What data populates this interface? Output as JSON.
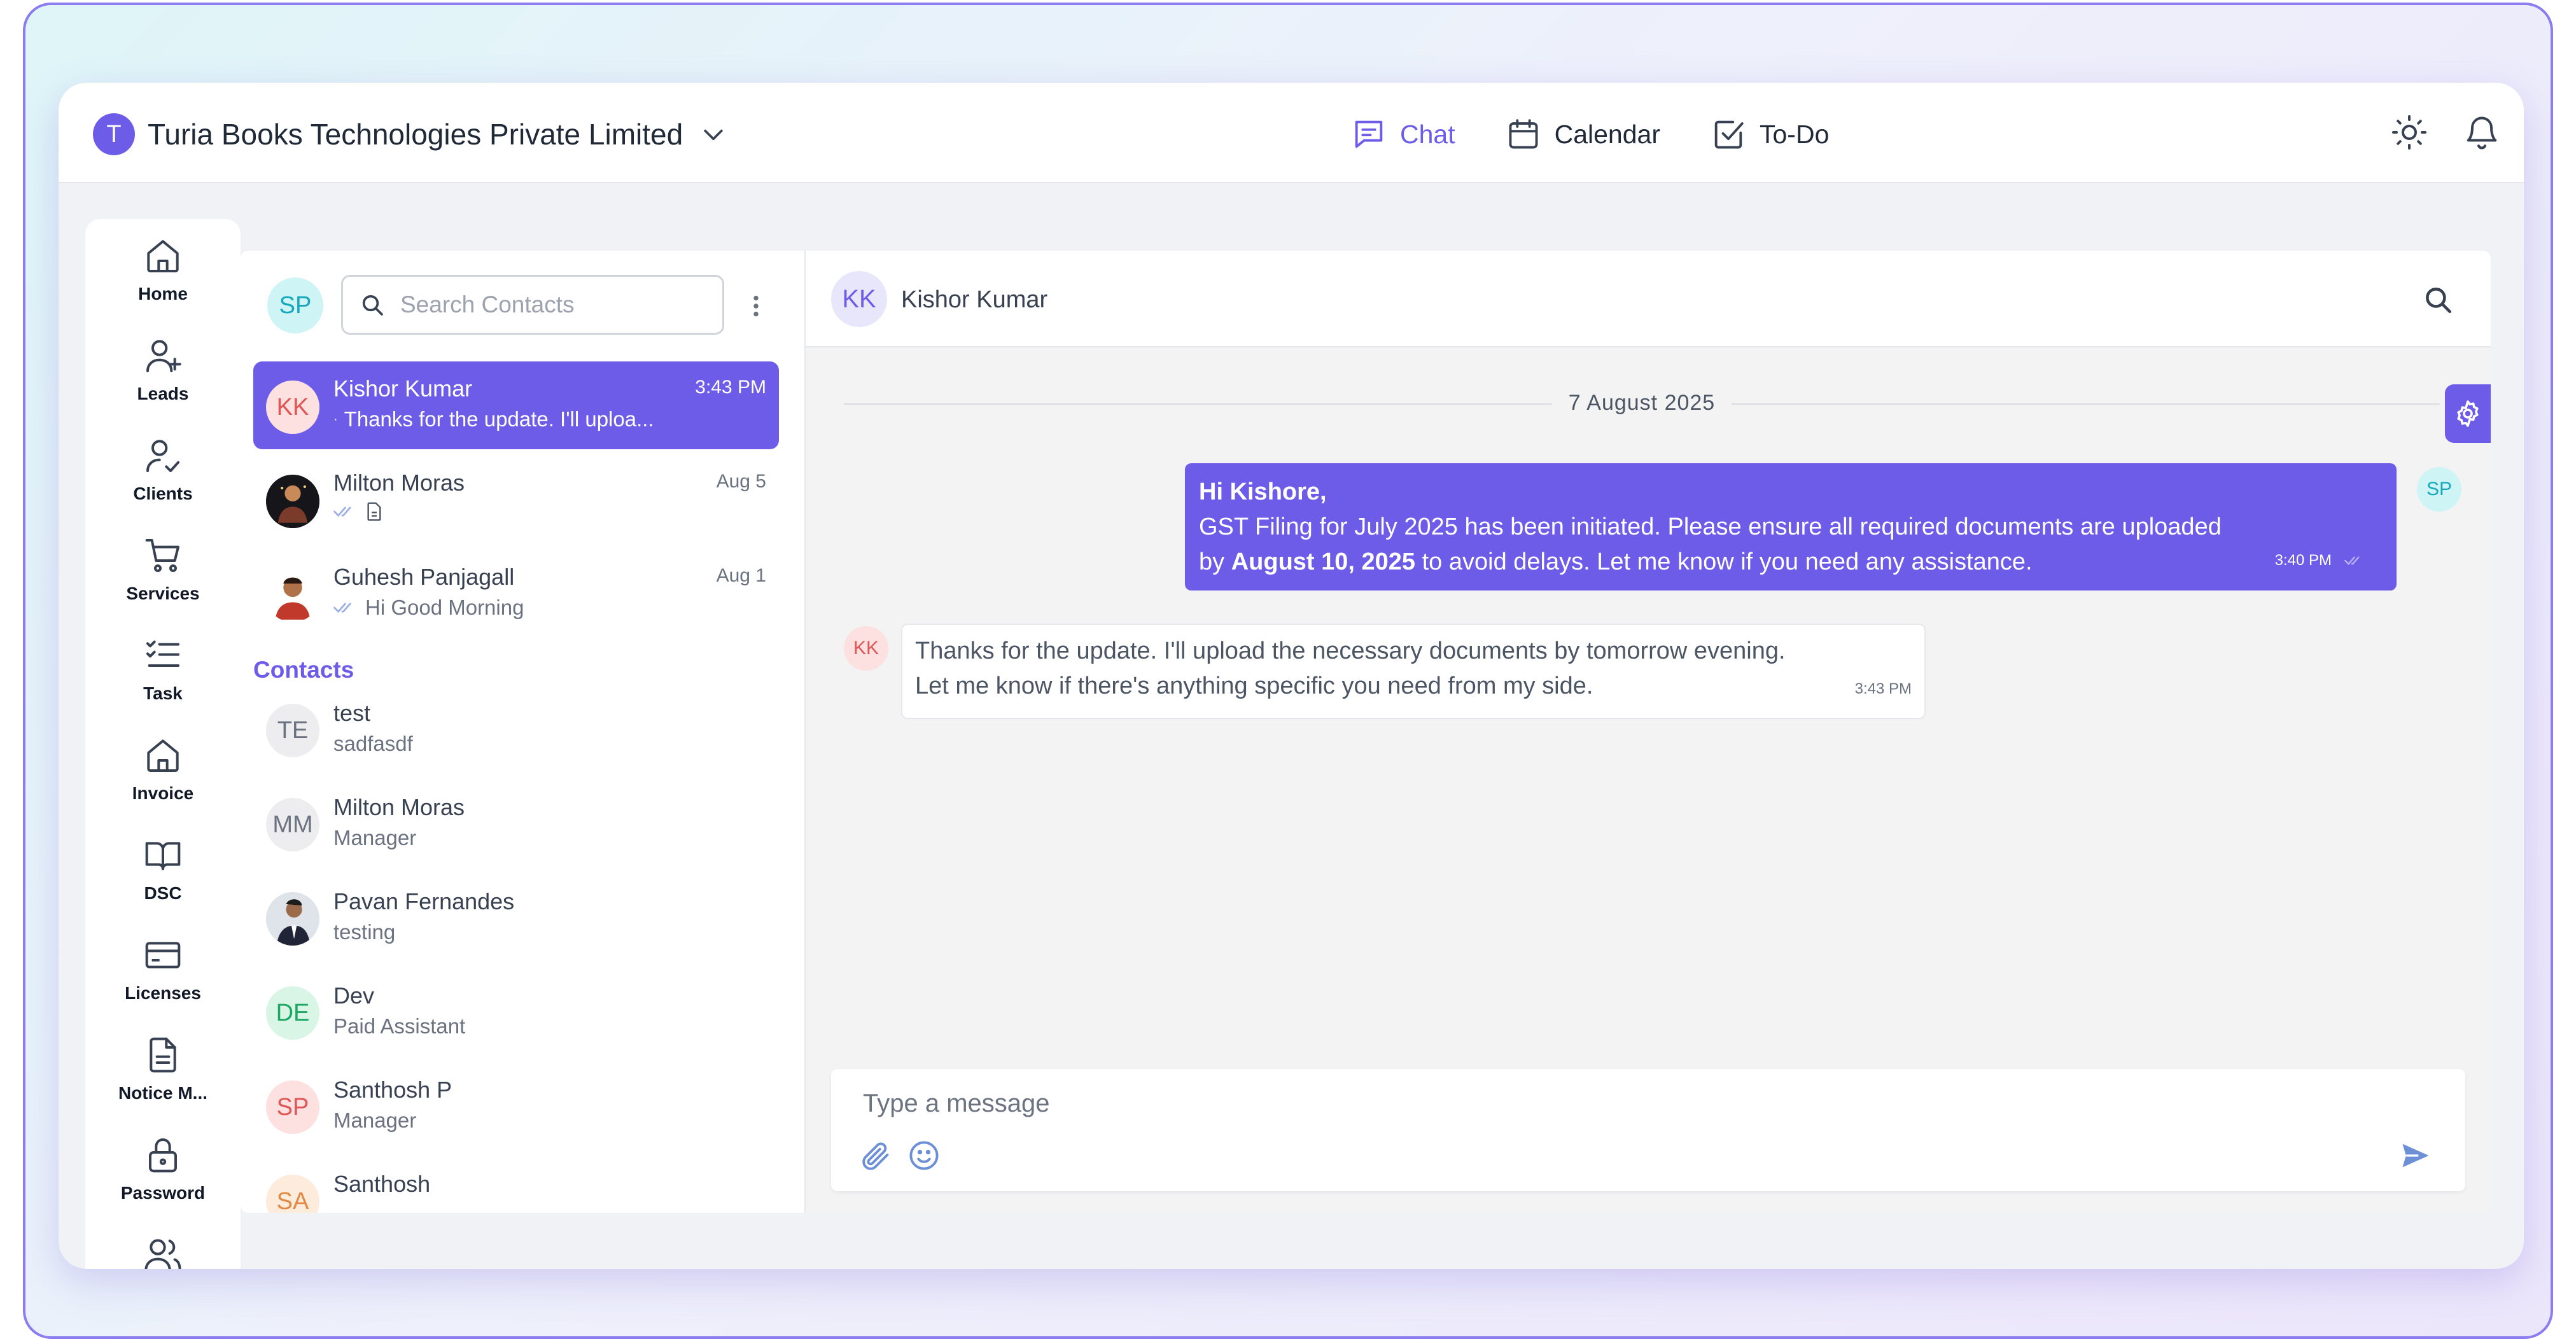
{
  "org": {
    "initial": "T",
    "name": "Turia Books Technologies Private Limited"
  },
  "topnav": [
    {
      "label": "Chat",
      "icon": "chat-icon",
      "active": true
    },
    {
      "label": "Calendar",
      "icon": "calendar-icon",
      "active": false
    },
    {
      "label": "To-Do",
      "icon": "checkbox-icon",
      "active": false
    }
  ],
  "sidebar": {
    "items": [
      {
        "label": "Home",
        "icon": "home-icon"
      },
      {
        "label": "Leads",
        "icon": "user-plus-icon"
      },
      {
        "label": "Clients",
        "icon": "user-check-icon"
      },
      {
        "label": "Services",
        "icon": "cart-icon"
      },
      {
        "label": "Task",
        "icon": "list-check-icon"
      },
      {
        "label": "Invoice",
        "icon": "home-icon"
      },
      {
        "label": "DSC",
        "icon": "book-icon"
      },
      {
        "label": "Licenses",
        "icon": "card-icon"
      },
      {
        "label": "Notice M...",
        "icon": "document-icon"
      },
      {
        "label": "Password",
        "icon": "lock-icon"
      }
    ]
  },
  "me": {
    "initials": "SP"
  },
  "search": {
    "placeholder": "Search Contacts"
  },
  "conversations": [
    {
      "initials": "KK",
      "name": "Kishor Kumar",
      "time": "3:43 PM",
      "preview": "Thanks for the update. I'll uploa..."
    },
    {
      "initials": "",
      "name": "Milton Moras",
      "time": "Aug 5",
      "preview": ""
    },
    {
      "initials": "",
      "name": "Guhesh Panjagall",
      "time": "Aug 1",
      "preview": "Hi Good Morning"
    }
  ],
  "contacts_heading": "Contacts",
  "contacts": [
    {
      "initials": "TE",
      "name": "test",
      "subtitle": "sadfasdf"
    },
    {
      "initials": "MM",
      "name": "Milton Moras",
      "subtitle": "Manager"
    },
    {
      "initials": "",
      "name": "Pavan Fernandes",
      "subtitle": "testing"
    },
    {
      "initials": "DE",
      "name": "Dev",
      "subtitle": "Paid Assistant"
    },
    {
      "initials": "SP",
      "name": "Santhosh P",
      "subtitle": "Manager"
    },
    {
      "initials": "SA",
      "name": "Santhosh",
      "subtitle": ""
    }
  ],
  "chat": {
    "contact_initials": "KK",
    "contact_name": "Kishor Kumar",
    "date": "7 August 2025",
    "outgoing": {
      "greeting": "Hi Kishore,",
      "line1": "GST Filing for July 2025 has been initiated. Please ensure all required documents are uploaded",
      "line2_pre": "by ",
      "line2_bold": "August 10, 2025",
      "line2_post": " to avoid delays. Let me know if you need any assistance.",
      "time": "3:40 PM",
      "sender_initials": "SP"
    },
    "incoming": {
      "sender_initials": "KK",
      "line1": "Thanks for the update. I'll upload the necessary documents by tomorrow evening.",
      "line2": "Let me know if there's anything specific you need from my side.",
      "time": "3:43 PM"
    },
    "composer_placeholder": "Type a message"
  },
  "colors": {
    "accent": "#6d5ce8",
    "sp_bg": "#cff4f6",
    "kk_bg": "#fde0e0",
    "de_bg": "#d8f5e6"
  }
}
